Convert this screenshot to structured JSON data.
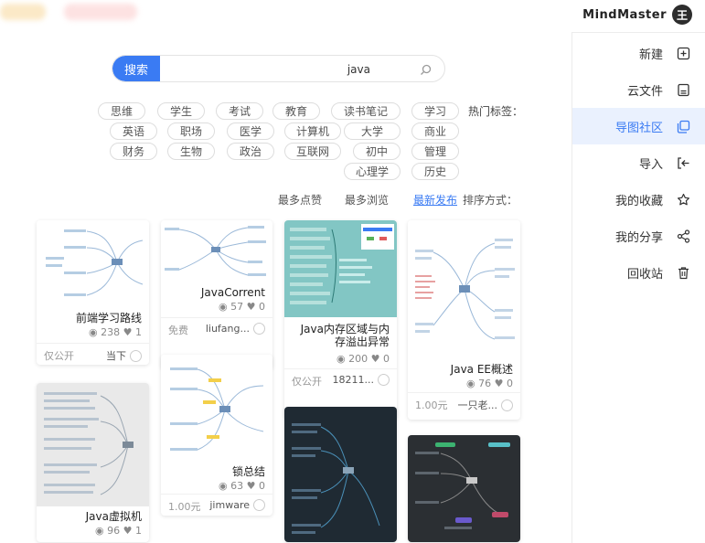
{
  "brand": {
    "name": "MindMaster",
    "logo_letter": "王"
  },
  "sidebar": {
    "items": [
      {
        "label": "新建",
        "icon": "new-file-icon",
        "active": false
      },
      {
        "label": "云文件",
        "icon": "cloud-file-icon",
        "active": false
      },
      {
        "label": "导图社区",
        "icon": "community-icon",
        "active": true
      },
      {
        "label": "导入",
        "icon": "import-icon",
        "active": false
      },
      {
        "label": "我的收藏",
        "icon": "star-icon",
        "active": false
      },
      {
        "label": "我的分享",
        "icon": "share-icon",
        "active": false
      },
      {
        "label": "回收站",
        "icon": "trash-icon",
        "active": false
      }
    ]
  },
  "search": {
    "button_label": "搜索",
    "value": "java"
  },
  "tags": {
    "label": "热门标签：",
    "items": [
      "学习",
      "读书笔记",
      "教育",
      "考试",
      "学生",
      "思维",
      "商业",
      "大学",
      "计算机",
      "医学",
      "职场",
      "英语",
      "管理",
      "初中",
      "互联网",
      "政治",
      "生物",
      "财务",
      "历史",
      "心理学"
    ]
  },
  "sort": {
    "label": "排序方式：",
    "options": [
      "最新发布",
      "最多浏览",
      "最多点赞"
    ],
    "active": "最新发布"
  },
  "cards": [
    {
      "title": "Java EE概述",
      "views": "76",
      "likes": "0",
      "author": "一只老...",
      "price": "1.00元"
    },
    {
      "title": "Java内存区域与内存溢出异常",
      "views": "200",
      "likes": "0",
      "author": "18211...",
      "price": "仅公开"
    },
    {
      "title": "JavaCorrent",
      "views": "57",
      "likes": "0",
      "author": "liufang...",
      "price": "免费"
    },
    {
      "title": "前端学习路线",
      "views": "238",
      "likes": "1",
      "author": "当下",
      "price": "仅公开"
    },
    {
      "title": "锁总结",
      "views": "63",
      "likes": "0",
      "author": "jimware",
      "price": "1.00元"
    },
    {
      "title": "Java虚拟机",
      "views": "96",
      "likes": "1",
      "author": "",
      "price": ""
    }
  ],
  "colors": {
    "accent": "#3a7bf3",
    "active_bg": "#eaf1fe"
  }
}
